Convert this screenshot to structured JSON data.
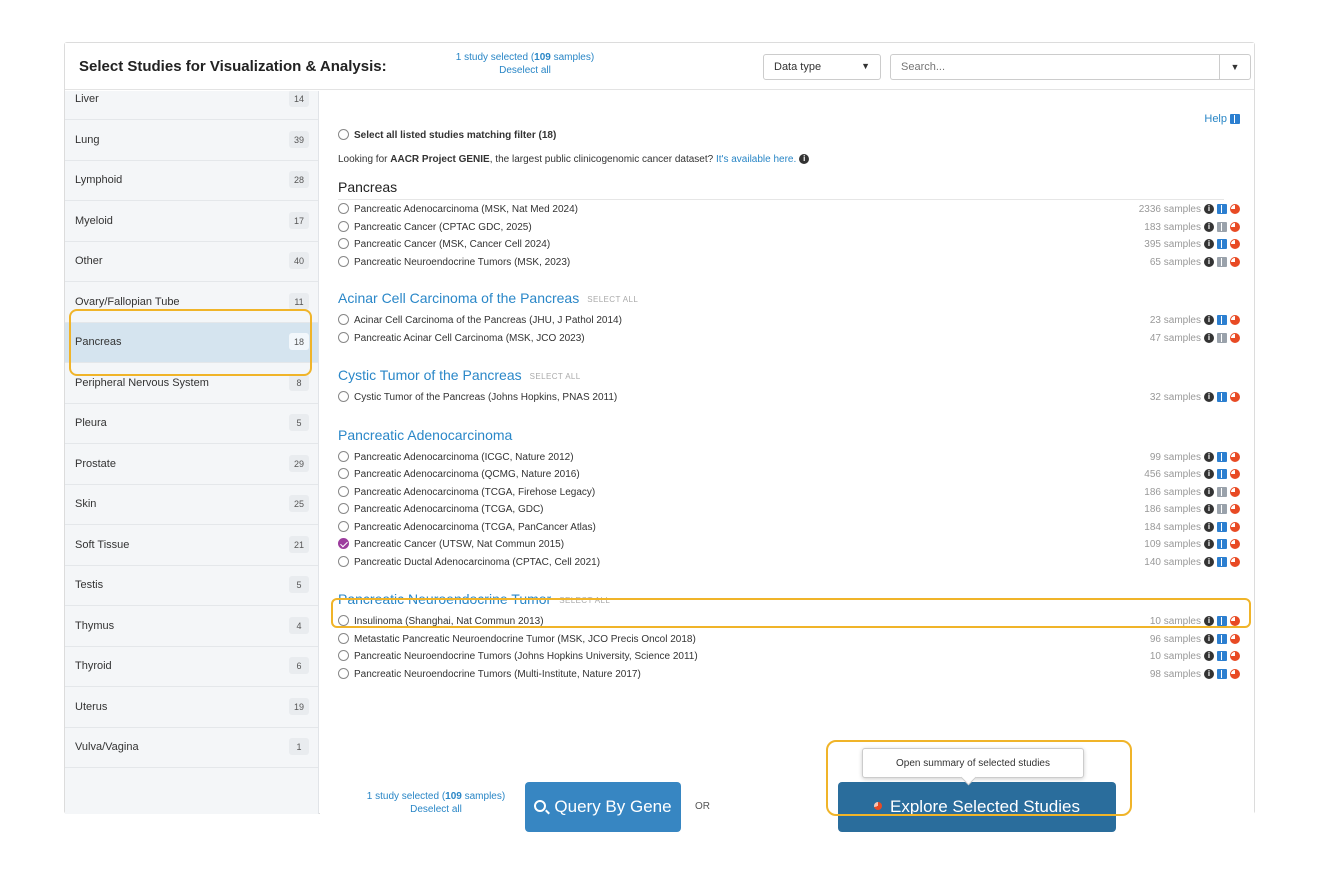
{
  "header": {
    "title": "Select Studies for Visualization & Analysis:",
    "selection_count": "1 study selected",
    "selection_samples_num": "109",
    "selection_samples_prefix": " (",
    "selection_samples_suffix": " samples)",
    "deselect_all": "Deselect all",
    "data_type_label": "Data type",
    "search_placeholder": "Search..."
  },
  "sidebar": {
    "items": [
      {
        "label": "Liver",
        "count": "14"
      },
      {
        "label": "Lung",
        "count": "39"
      },
      {
        "label": "Lymphoid",
        "count": "28"
      },
      {
        "label": "Myeloid",
        "count": "17"
      },
      {
        "label": "Other",
        "count": "40"
      },
      {
        "label": "Ovary/Fallopian Tube",
        "count": "11"
      },
      {
        "label": "Pancreas",
        "count": "18"
      },
      {
        "label": "Peripheral Nervous System",
        "count": "8"
      },
      {
        "label": "Pleura",
        "count": "5"
      },
      {
        "label": "Prostate",
        "count": "29"
      },
      {
        "label": "Skin",
        "count": "25"
      },
      {
        "label": "Soft Tissue",
        "count": "21"
      },
      {
        "label": "Testis",
        "count": "5"
      },
      {
        "label": "Thymus",
        "count": "4"
      },
      {
        "label": "Thyroid",
        "count": "6"
      },
      {
        "label": "Uterus",
        "count": "19"
      },
      {
        "label": "Vulva/Vagina",
        "count": "1"
      }
    ],
    "active_item": "Pancreas"
  },
  "content": {
    "select_all_listed": "Select all listed studies matching filter (18)",
    "help": "Help",
    "genie_prefix": "Looking for ",
    "genie_bold": "AACR Project GENIE",
    "genie_middle": ", the largest public clinicogenomic cancer dataset? ",
    "genie_link": "It's available here.",
    "group_title": "Pancreas",
    "select_all_tag": "SELECT ALL",
    "top_studies": [
      {
        "name": "Pancreatic Adenocarcinoma (MSK, Nat Med 2024)",
        "samples": "2336 samples",
        "book": "blue"
      },
      {
        "name": "Pancreatic Cancer (CPTAC GDC, 2025)",
        "samples": "183 samples",
        "book": "grey"
      },
      {
        "name": "Pancreatic Cancer (MSK, Cancer Cell 2024)",
        "samples": "395 samples",
        "book": "blue"
      },
      {
        "name": "Pancreatic Neuroendocrine Tumors (MSK, 2023)",
        "samples": "65 samples",
        "book": "grey"
      }
    ],
    "categories": [
      {
        "title": "Acinar Cell Carcinoma of the Pancreas",
        "show_select_all": true,
        "studies": [
          {
            "name": "Acinar Cell Carcinoma of the Pancreas (JHU, J Pathol 2014)",
            "samples": "23 samples",
            "book": "blue"
          },
          {
            "name": "Pancreatic Acinar Cell Carcinoma (MSK, JCO 2023)",
            "samples": "47 samples",
            "book": "grey"
          }
        ]
      },
      {
        "title": "Cystic Tumor of the Pancreas",
        "show_select_all": true,
        "studies": [
          {
            "name": "Cystic Tumor of the Pancreas (Johns Hopkins, PNAS 2011)",
            "samples": "32 samples",
            "book": "blue"
          }
        ]
      },
      {
        "title": "Pancreatic Adenocarcinoma",
        "show_select_all": false,
        "studies": [
          {
            "name": "Pancreatic Adenocarcinoma (ICGC, Nature 2012)",
            "samples": "99 samples",
            "book": "blue"
          },
          {
            "name": "Pancreatic Adenocarcinoma (QCMG, Nature 2016)",
            "samples": "456 samples",
            "book": "blue"
          },
          {
            "name": "Pancreatic Adenocarcinoma (TCGA, Firehose Legacy)",
            "samples": "186 samples",
            "book": "grey"
          },
          {
            "name": "Pancreatic Adenocarcinoma (TCGA, GDC)",
            "samples": "186 samples",
            "book": "grey"
          },
          {
            "name": "Pancreatic Adenocarcinoma (TCGA, PanCancer Atlas)",
            "samples": "184 samples",
            "book": "blue"
          },
          {
            "name": "Pancreatic Cancer (UTSW, Nat Commun 2015)",
            "samples": "109 samples",
            "book": "blue",
            "checked": true
          },
          {
            "name": "Pancreatic Ductal Adenocarcinoma (CPTAC, Cell 2021)",
            "samples": "140 samples",
            "book": "blue"
          }
        ]
      },
      {
        "title": "Pancreatic Neuroendocrine Tumor",
        "show_select_all": true,
        "studies": [
          {
            "name": "Insulinoma (Shanghai, Nat Commun 2013)",
            "samples": "10 samples",
            "book": "blue"
          },
          {
            "name": "Metastatic Pancreatic Neuroendocrine Tumor (MSK, JCO Precis Oncol 2018)",
            "samples": "96 samples",
            "book": "blue"
          },
          {
            "name": "Pancreatic Neuroendocrine Tumors (Johns Hopkins University, Science 2011)",
            "samples": "10 samples",
            "book": "blue"
          },
          {
            "name": "Pancreatic Neuroendocrine Tumors (Multi-Institute, Nature 2017)",
            "samples": "98 samples",
            "book": "blue"
          }
        ]
      }
    ]
  },
  "footer": {
    "selection_count": "1 study selected",
    "selection_samples_num": "109",
    "selection_samples_prefix": " (",
    "selection_samples_suffix": " samples)",
    "deselect_all": "Deselect all",
    "query_button": "Query By Gene",
    "or_label": "OR",
    "explore_button": "Explore Selected Studies",
    "tooltip": "Open summary of selected studies"
  },
  "colors": {
    "link": "#2986c6",
    "button": "#3786c2",
    "highlight": "#f0b429",
    "checked": "#9c3d9e"
  }
}
